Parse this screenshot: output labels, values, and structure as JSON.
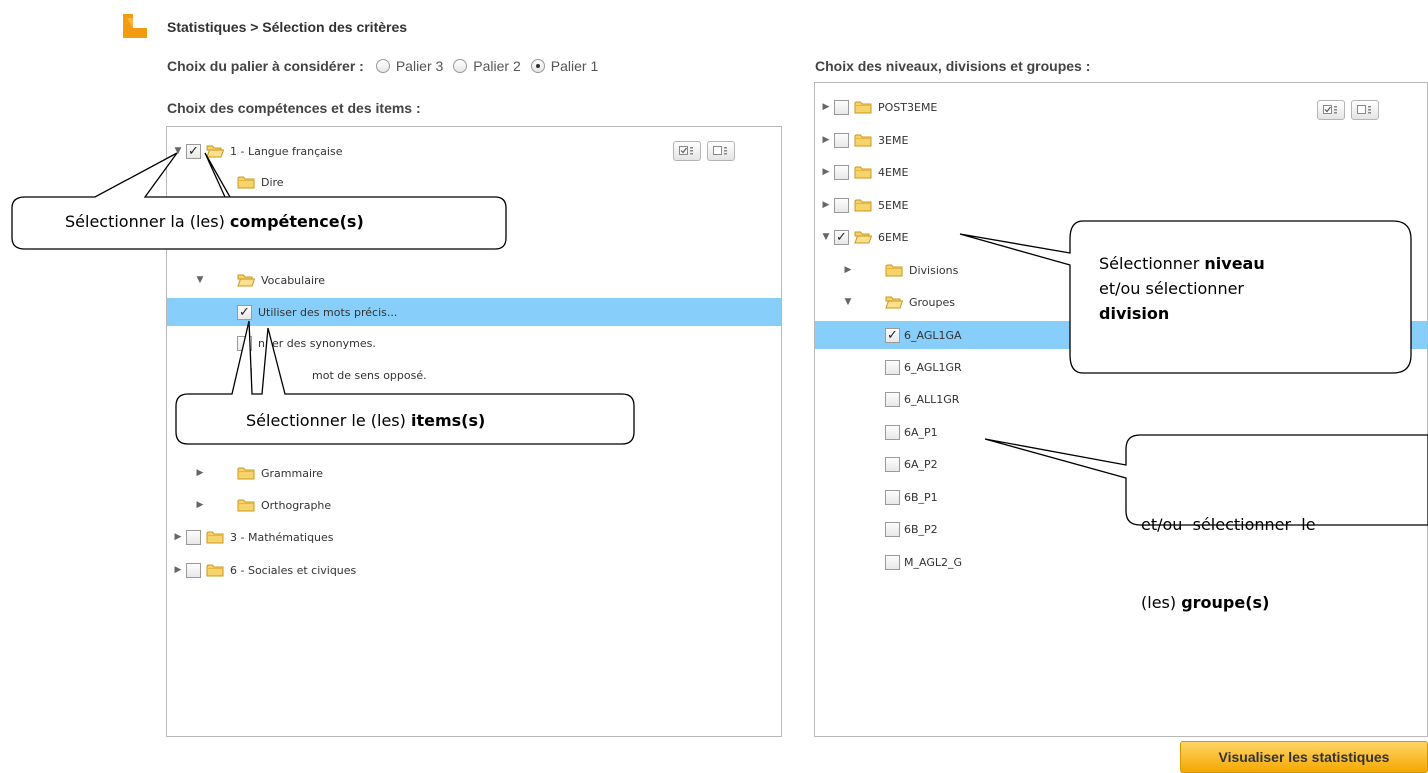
{
  "breadcrumb": "Statistiques > Sélection des critères",
  "palier": {
    "label": "Choix du palier à considérer :",
    "options": [
      "Palier 3",
      "Palier 2",
      "Palier 1"
    ],
    "selected": "Palier 1"
  },
  "competences": {
    "label": "Choix des compétences et des items :",
    "nodes": {
      "langue_francaise": "1 - Langue française",
      "dire": "Dire",
      "vocabulaire": "Vocabulaire",
      "item_mots_precis": "Utiliser des mots précis...",
      "item_synonymes_partial": "nner des synonymes.",
      "item_oppose_partial": "mot de sens opposé.",
      "grammaire": "Grammaire",
      "orthographe": "Orthographe",
      "mathematiques": "3 - Mathématiques",
      "sociales_civiques": "6 - Sociales et civiques"
    }
  },
  "niveaux": {
    "label": "Choix des niveaux, divisions et groupes :",
    "nodes": {
      "post3eme": "POST3EME",
      "n3eme": "3EME",
      "n4eme": "4EME",
      "n5eme": "5EME",
      "n6eme": "6EME",
      "divisions": "Divisions",
      "groupes": "Groupes",
      "g1": "6_AGL1GA",
      "g2": "6_AGL1GR",
      "g3": "6_ALL1GR",
      "g4": "6A_P1",
      "g5": "6A_P2",
      "g6": "6B_P1",
      "g7": "6B_P2",
      "g8": "M_AGL2_G"
    }
  },
  "callouts": {
    "competence_prefix": "Sélectionner la (les)",
    "competence_bold": "compétence(s)",
    "items_prefix": "Sélectionner le (les)",
    "items_bold": "items(s)",
    "niveau_line1": "Sélectionner",
    "niveau_bold1": "niveau",
    "niveau_line2": "et/ou sélectionner",
    "niveau_bold2": "division",
    "groupe_line1": "et/ou  sélectionner  le",
    "groupe_prefix": "(les)",
    "groupe_bold": "groupe(s)"
  },
  "submit_label": "Visualiser les statistiques",
  "colors": {
    "selected_row": "#87cefa",
    "accent": "#f5a800",
    "folder": "#f2c94c"
  }
}
